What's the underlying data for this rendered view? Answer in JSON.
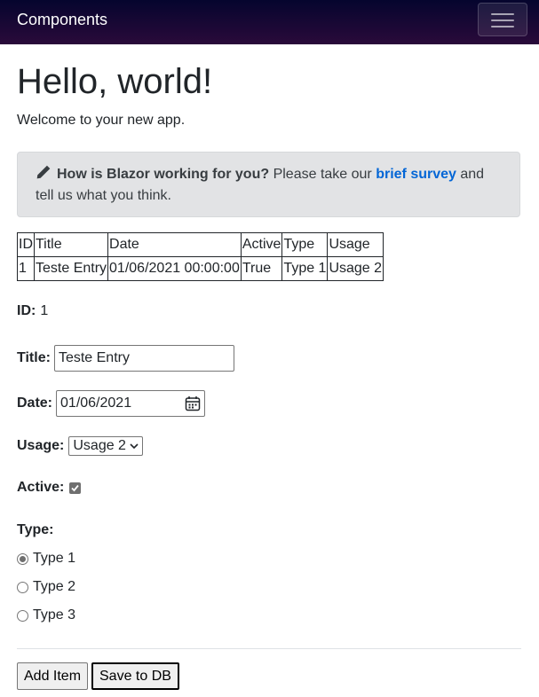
{
  "navbar": {
    "brand": "Components"
  },
  "main": {
    "heading": "Hello, world!",
    "welcome": "Welcome to your new app."
  },
  "survey": {
    "question": "How is Blazor working for you?",
    "text_before": " Please take our ",
    "link": "brief survey",
    "text_after": " and tell us what you think."
  },
  "table": {
    "headers": [
      "ID",
      "Title",
      "Date",
      "Active",
      "Type",
      "Usage"
    ],
    "rows": [
      [
        "1",
        "Teste Entry",
        "01/06/2021 00:00:00",
        "True",
        "Type 1",
        "Usage 2"
      ]
    ]
  },
  "form": {
    "id_label": "ID:",
    "id_value": "1",
    "title_label": "Title:",
    "title_value": "Teste Entry",
    "date_label": "Date:",
    "date_value": "01/06/2021",
    "usage_label": "Usage:",
    "usage_value": "Usage 2",
    "active_label": "Active:",
    "active_checked": true,
    "type_label": "Type:",
    "type_options": [
      "Type 1",
      "Type 2",
      "Type 3"
    ],
    "type_selected": "Type 1"
  },
  "buttons": {
    "add": "Add Item",
    "save": "Save to DB"
  },
  "icons": {
    "menu": "hamburger-menu-icon",
    "survey": "pencil-icon",
    "date": "calendar-icon",
    "select": "chevron-down-icon"
  }
}
